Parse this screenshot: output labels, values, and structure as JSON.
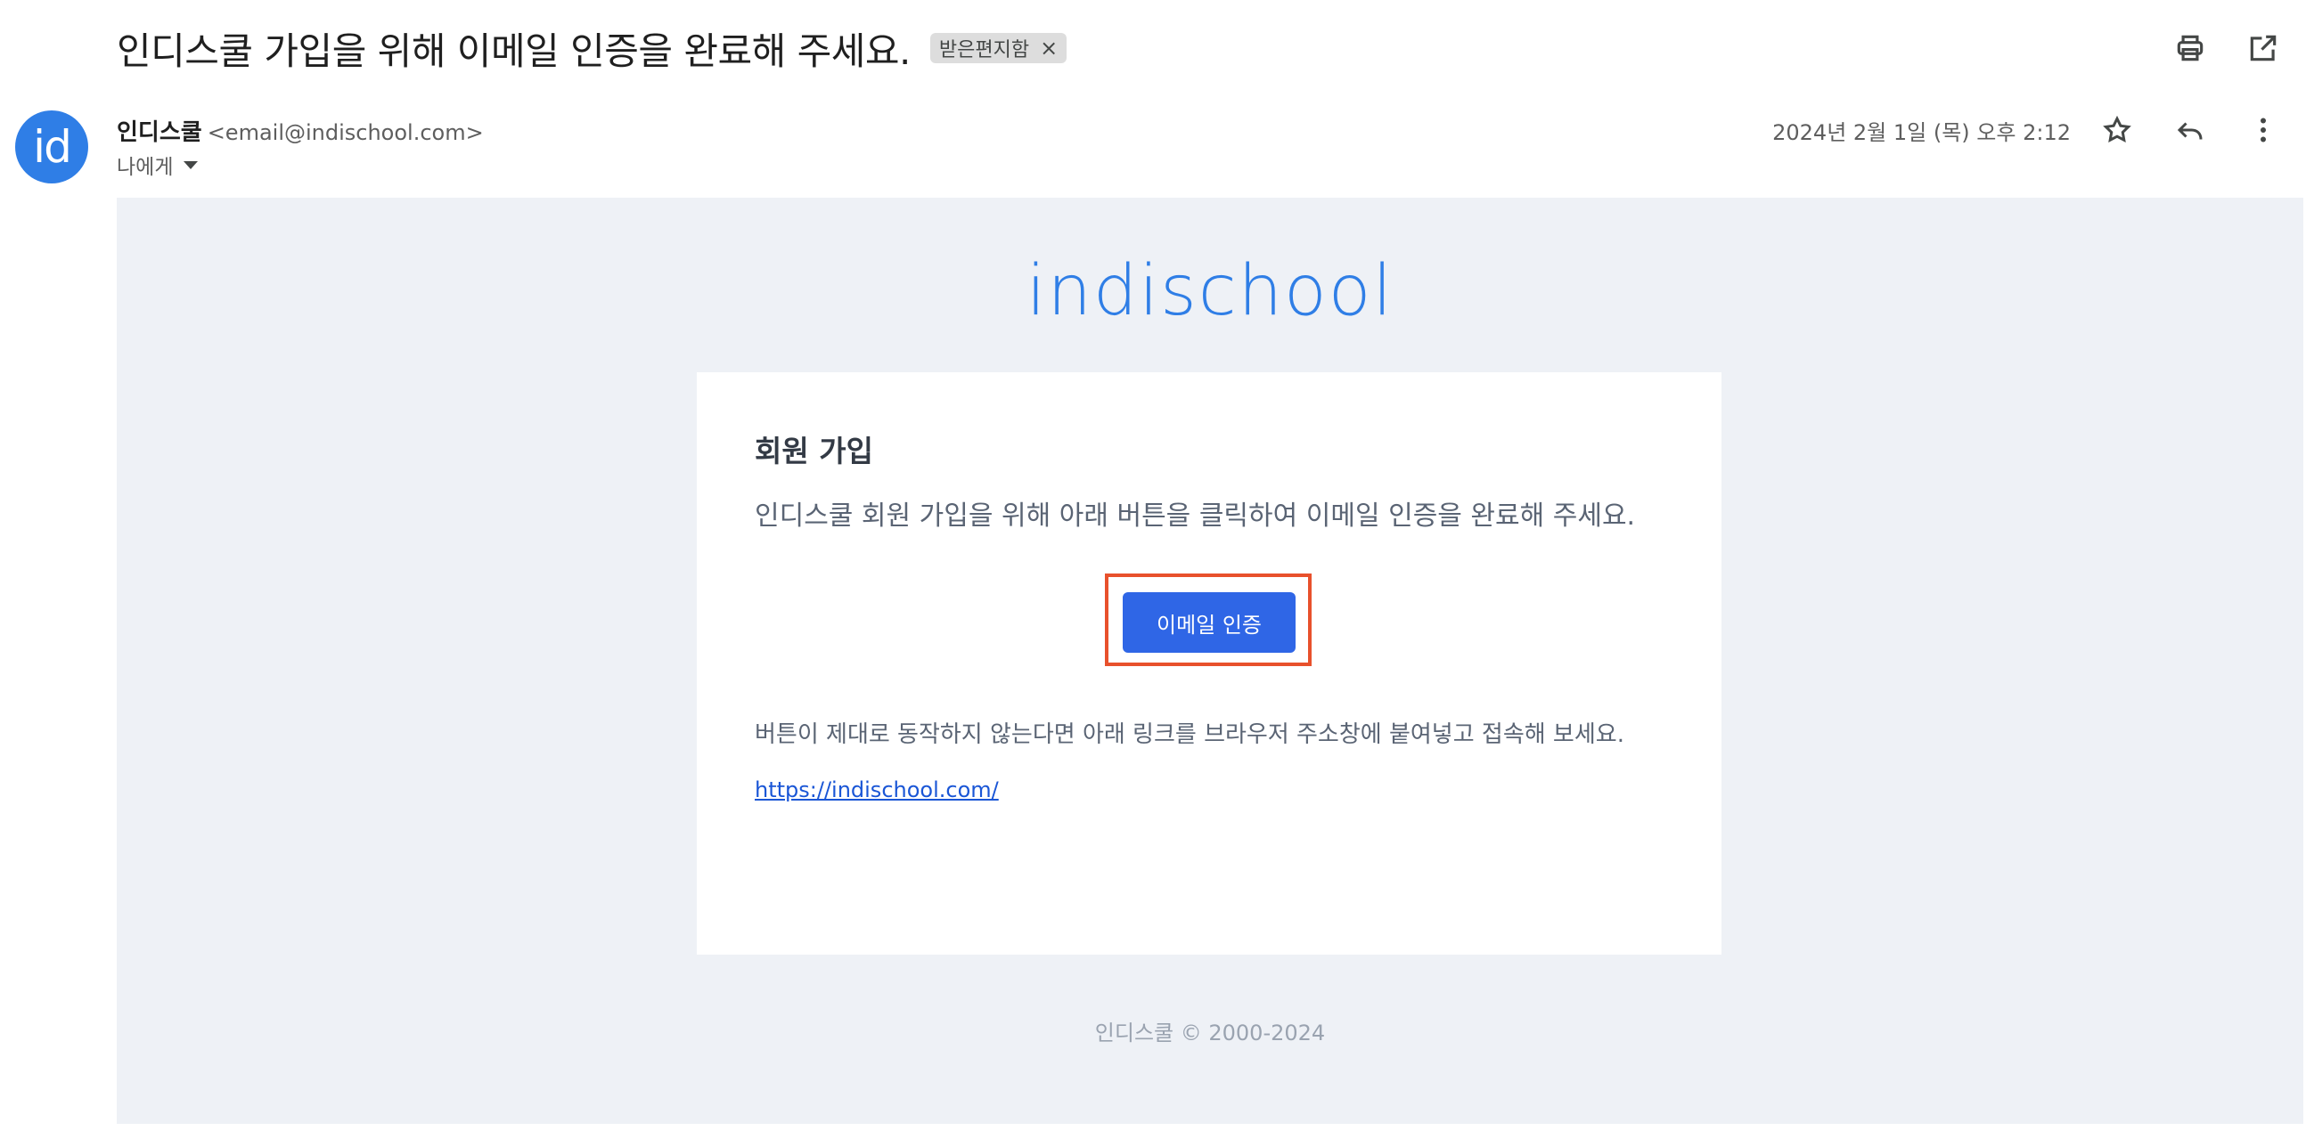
{
  "email": {
    "subject": "인디스쿨 가입을 위해 이메일 인증을 완료해 주세요.",
    "label_chip": "받은편지함",
    "label_close": "×",
    "sender_name": "인디스쿨",
    "sender_email": "<email@indischool.com>",
    "recipient": "나에게",
    "date": "2024년 2월 1일 (목) 오후 2:12",
    "avatar_text": "id"
  },
  "icons": {
    "print": "print-icon",
    "open_new_window": "open-in-new-icon",
    "star": "star-icon",
    "reply": "reply-icon",
    "more": "more-vertical-icon"
  },
  "body": {
    "brand": "indischool",
    "card_title": "회원 가입",
    "card_message": "인디스쿨 회원 가입을 위해 아래 버튼을 클릭하여 이메일 인증을 완료해 주세요.",
    "button_label": "이메일 인증",
    "fallback_text": "버튼이 제대로 동작하지 않는다면 아래 링크를 브라우저 주소창에 붙여넣고 접속해 보세요.",
    "fallback_link": "https://indischool.com/",
    "footer": "인디스쿨 © 2000-2024"
  },
  "colors": {
    "brand": "#2f7ee6",
    "button": "#2f66e6",
    "highlight": "#e8512c",
    "body_background": "#eef1f6"
  }
}
